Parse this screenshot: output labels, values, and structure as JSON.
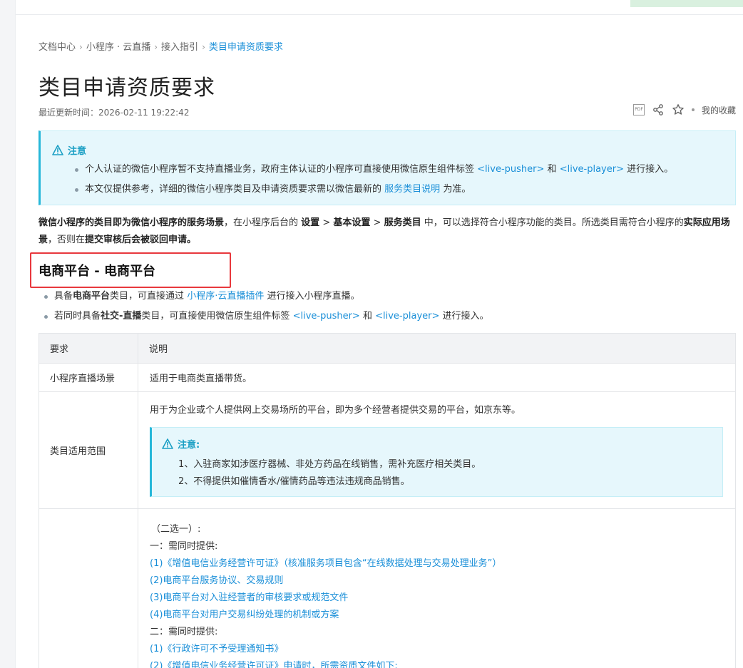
{
  "breadcrumb": {
    "items": [
      "文档中心",
      "小程序 · 云直播",
      "接入指引"
    ],
    "current": "类目申请资质要求",
    "separator": "›"
  },
  "page": {
    "title": "类目申请资质要求",
    "updated": "最近更新时间：2026-02-11 19:22:42",
    "favorite_label": "我的收藏",
    "pdf_label": "PDF"
  },
  "notice": {
    "title": "注意",
    "item1": {
      "t1": "个人认证的微信小程序暂不支持直播业务，政府主体认证的小程序可直接使用微信原生组件标签",
      "link1": "<live-pusher>",
      "t2": "和",
      "link2": "<live-player>",
      "t3": "进行接入。"
    },
    "item2": {
      "t1": "本文仅提供参考，详细的微信小程序类目及申请资质要求需以微信最新的",
      "link1": "服务类目说明",
      "t2": "为准。"
    }
  },
  "intro": {
    "b1": "微信小程序的类目即为微信小程序的服务场景",
    "t1": "，在小程序后台的",
    "b2": "设置",
    "t2": ">",
    "b3": "基本设置",
    "t3": ">",
    "b4": "服务类目",
    "t4": "中，可以选择符合小程序功能的类目。所选类目需符合小程序的",
    "b5": "实际应用场景",
    "t5": "，否则在",
    "b6": "提交审核后会被驳回申请。"
  },
  "section": {
    "heading": "电商平台 - 电商平台",
    "item1": {
      "t1": "具备",
      "b1": "电商平台",
      "t2": "类目，可直接通过",
      "link": "小程序·云直播插件",
      "t3": "进行接入小程序直播。"
    },
    "item2": {
      "t1": "若同时具备",
      "b1": "社交-直播",
      "t2": "类目，可直接使用微信原生组件标签",
      "link1": "<live-pusher>",
      "t3": "和",
      "link2": "<live-player>",
      "t4": "进行接入。"
    }
  },
  "table": {
    "headers": [
      "要求",
      "说明"
    ],
    "row1": {
      "label": "小程序直播场景",
      "desc": "适用于电商类直播带货。"
    },
    "row2": {
      "label": "类目适用范围",
      "desc": "用于为企业或个人提供网上交易场所的平台，即为多个经营者提供交易的平台，如京东等。",
      "note_title": "注意:",
      "note1": "1、入驻商家如涉医疗器械、非处方药品在线销售，需补充医疗相关类目。",
      "note2": "2、不得提供如催情香水/催情药品等违法违规商品销售。"
    },
    "row3": {
      "lines": [
        "（二选一）:",
        "一：需同时提供:",
        "(1)《增值电信业务经营许可证》（核准服务项目包含“在线数据处理与交易处理业务”）",
        "(2)电商平台服务协议、交易规则",
        "(3)电商平台对入驻经营者的审核要求或规范文件",
        "(4)电商平台对用户交易纠纷处理的机制或方案",
        "二：需同时提供:",
        "(1)《行政许可不予受理通知书》",
        "(2)《增值电信业务经营许可证》申请时，所需资质文件如下:"
      ]
    }
  },
  "colors": {
    "link": "#1a8fd8",
    "notice_bg": "#e6f7fc",
    "notice_accent": "#26b7d9",
    "highlight_box": "#e8383d"
  }
}
